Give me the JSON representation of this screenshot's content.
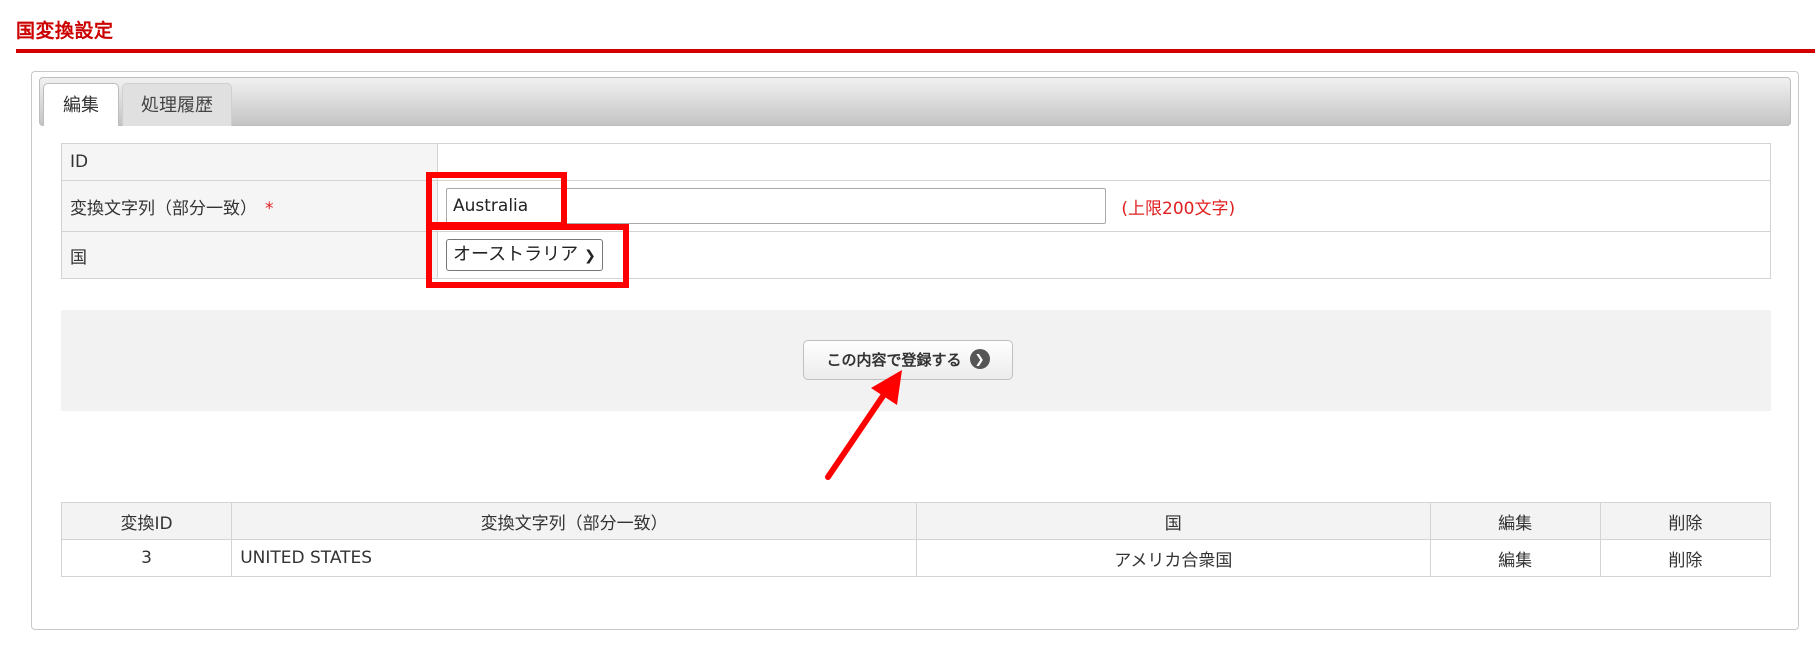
{
  "page": {
    "title": "国変換設定"
  },
  "tabs": [
    {
      "label": "編集",
      "active": true
    },
    {
      "label": "処理履歴",
      "active": false
    }
  ],
  "form": {
    "id_label": "ID",
    "id_value": "",
    "string_label": "変換文字列（部分一致）",
    "required_mark": "*",
    "string_value": "Australia",
    "string_limit": "(上限200文字)",
    "country_label": "国",
    "country_selected": "オーストラリア"
  },
  "submit": {
    "label": "この内容で登録する"
  },
  "list": {
    "headers": [
      "変換ID",
      "変換文字列（部分一致）",
      "国",
      "編集",
      "削除"
    ],
    "rows": [
      {
        "id": "3",
        "string": "UNITED STATES",
        "country": "アメリカ合衆国",
        "edit": "編集",
        "delete": "削除"
      }
    ]
  },
  "colors": {
    "accent": "#d40000",
    "highlight": "#ff0000",
    "required": "#e02020"
  }
}
